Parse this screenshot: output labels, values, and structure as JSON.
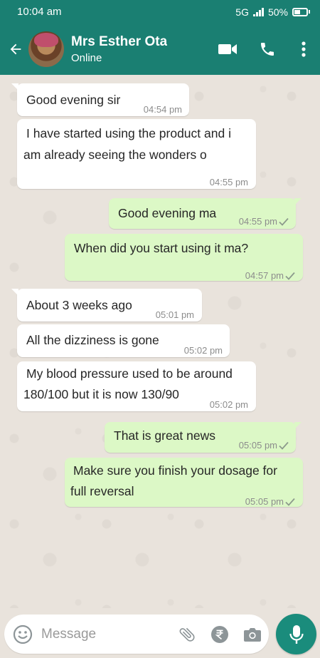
{
  "status_bar": {
    "time": "10:04 am",
    "network": "5G",
    "battery": "50%"
  },
  "header": {
    "contact_name": "Mrs Esther Ota",
    "contact_status": "Online",
    "icons": [
      "back-arrow-icon",
      "video-call-icon",
      "phone-icon",
      "more-vertical-icon"
    ]
  },
  "messages": [
    {
      "direction": "in",
      "lines": [
        "Good evening sir"
      ],
      "time": "04:54 pm"
    },
    {
      "direction": "in",
      "lines": [
        "I have started using the product and i",
        "am already seeing the wonders o"
      ],
      "time": "04:55 pm"
    },
    {
      "direction": "out",
      "lines": [
        "Good evening ma"
      ],
      "time": "04:55 pm"
    },
    {
      "direction": "out",
      "lines": [
        "When did you start using it ma?"
      ],
      "time": "04:57 pm"
    },
    {
      "direction": "in",
      "lines": [
        "About 3 weeks ago"
      ],
      "time": "05:01 pm"
    },
    {
      "direction": "in",
      "lines": [
        "All the dizziness is gone"
      ],
      "time": "05:02 pm"
    },
    {
      "direction": "in",
      "lines": [
        "My blood pressure used to be around",
        "180/100 but it is now 130/90"
      ],
      "time": "05:02 pm"
    },
    {
      "direction": "out",
      "lines": [
        "That is great news"
      ],
      "time": "05:05 pm"
    },
    {
      "direction": "out",
      "lines": [
        "Make sure you finish your dosage for",
        "full reversal"
      ],
      "time": "05:05 pm"
    }
  ],
  "input": {
    "placeholder": "Message"
  },
  "colors": {
    "brand": "#1a7f72",
    "incoming_bubble": "#ffffff",
    "outgoing_bubble": "#dcf8c6",
    "chat_background": "#e9e3dc"
  }
}
